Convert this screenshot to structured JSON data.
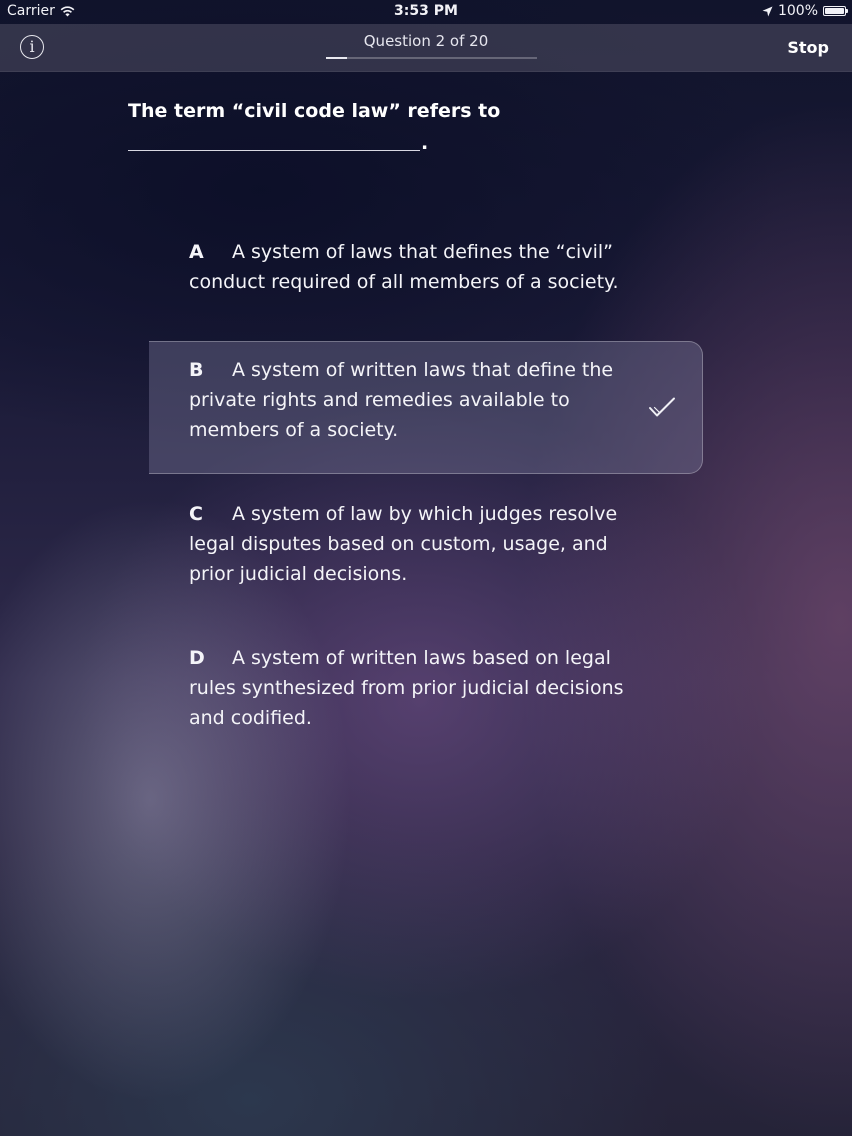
{
  "status_bar": {
    "carrier": "Carrier",
    "time": "3:53 PM",
    "battery": "100%"
  },
  "nav": {
    "title": "Question 2 of 20",
    "stop_label": "Stop",
    "info_label": "i",
    "progress": 0.1
  },
  "question": {
    "text": "The term “civil code law” refers to",
    "blank_end": "."
  },
  "answers": [
    {
      "letter": "A",
      "text": "A system of laws that defines the “civil” conduct required of all members of a society.",
      "selected": false
    },
    {
      "letter": "B",
      "text": "A system of written laws that define the private rights and remedies available to members of a society.",
      "selected": true
    },
    {
      "letter": "C",
      "text": "A system of law by which judges resolve legal disputes based on custom, usage, and prior judicial decisions.",
      "selected": false
    },
    {
      "letter": "D",
      "text": "A system of written laws based on legal rules synthesized from prior judicial decisions and codified.",
      "selected": false
    }
  ],
  "icons": {
    "wifi": "wifi-icon",
    "location": "location-arrow-icon",
    "battery": "battery-icon",
    "info": "info-icon",
    "check": "checkmark-icon"
  },
  "colors": {
    "text": "#ffffff",
    "selected_background": "#5b5676"
  }
}
